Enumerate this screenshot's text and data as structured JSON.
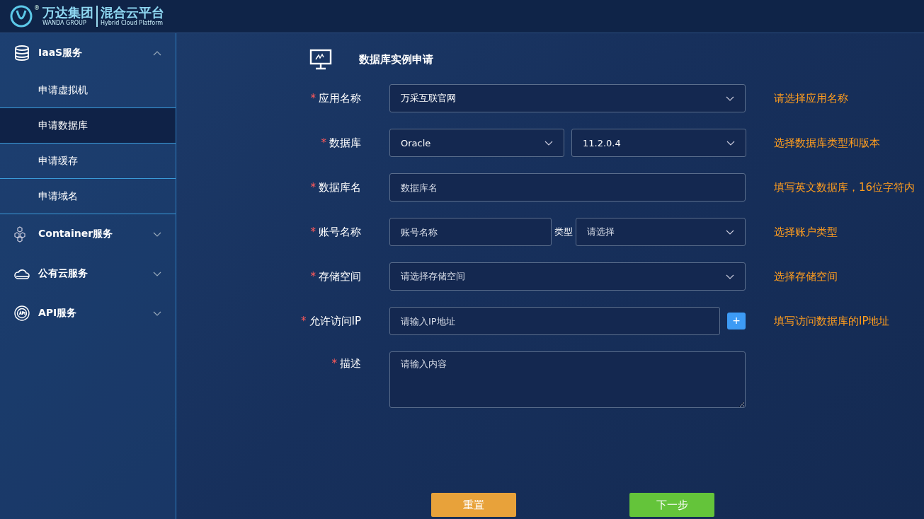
{
  "header": {
    "brand_cn": "万达集团",
    "registered": "®",
    "brand_en": "WANDA GROUP",
    "product_cn": "混合云平台",
    "product_en": "Hybrid Cloud Platform"
  },
  "sidebar": {
    "groups": [
      {
        "label": "IaaS服务",
        "expanded": true,
        "children": [
          {
            "label": "申请虚拟机",
            "selected": false
          },
          {
            "label": "申请数据库",
            "selected": true
          },
          {
            "label": "申请缓存",
            "selected": false
          },
          {
            "label": "申请域名",
            "selected": false
          }
        ]
      },
      {
        "label": "Container服务",
        "expanded": false
      },
      {
        "label": "公有云服务",
        "expanded": false
      },
      {
        "label": "API服务",
        "expanded": false
      }
    ]
  },
  "form": {
    "title": "数据库实例申请",
    "fields": [
      {
        "kind": "select",
        "label": "应用名称",
        "required_mark": "*",
        "value": "万采互联官网",
        "hint": "请选择应用名称"
      },
      {
        "kind": "select-pair",
        "label": "数据库",
        "required_mark": "*",
        "value": "Oracle",
        "value_2": "11.2.0.4",
        "hint": "选择数据库类型和版本"
      },
      {
        "kind": "input",
        "label": "数据库名",
        "required_mark": "*",
        "placeholder": "数据库名",
        "hint": "填写英文数据库，16位字符内"
      },
      {
        "kind": "input-select",
        "label": "账号名称",
        "required_mark": "*",
        "placeholder": "账号名称",
        "inner_label": "类型",
        "select_placeholder": "请选择",
        "hint": "选择账户类型"
      },
      {
        "kind": "select",
        "label": "存储空间",
        "required_mark": "*",
        "placeholder": "请选择存储空间",
        "hint": "选择存储空间"
      },
      {
        "kind": "input-add",
        "label": "允许访问IP",
        "required_mark": "*",
        "placeholder": "请输入IP地址",
        "add": "+",
        "hint": "填写访问数据库的IP地址"
      },
      {
        "kind": "textarea",
        "label": "描述",
        "required_mark": "*",
        "placeholder": "请输入内容"
      }
    ],
    "buttons": [
      {
        "label": "重置",
        "kind": "reset"
      },
      {
        "label": "下一步",
        "kind": "next"
      }
    ]
  }
}
